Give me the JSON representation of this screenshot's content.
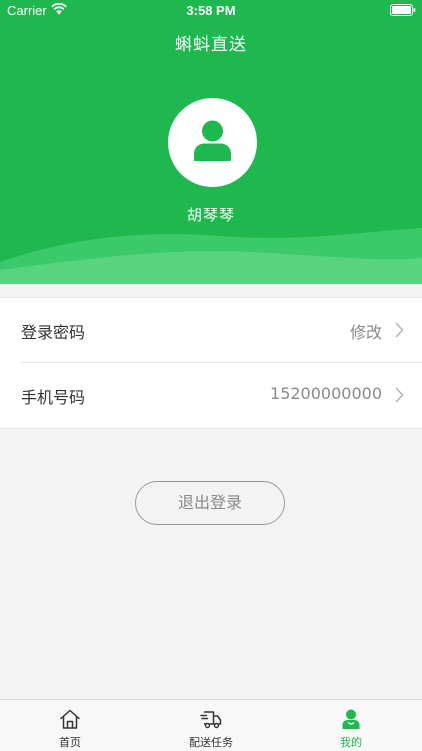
{
  "status_bar": {
    "carrier": "Carrier",
    "time": "3:58 PM"
  },
  "header": {
    "title": "蝌蚪直送",
    "user_name": "胡琴琴"
  },
  "settings": [
    {
      "label": "登录密码",
      "value": "修改"
    },
    {
      "label": "手机号码",
      "value": "15200000000"
    }
  ],
  "logout_label": "退出登录",
  "tabs": [
    {
      "label": "首页",
      "icon": "home-icon"
    },
    {
      "label": "配送任务",
      "icon": "delivery-truck-icon"
    },
    {
      "label": "我的",
      "icon": "profile-icon"
    }
  ],
  "colors": {
    "brand_green": "#1fb84f",
    "background": "#f3f3f3"
  }
}
